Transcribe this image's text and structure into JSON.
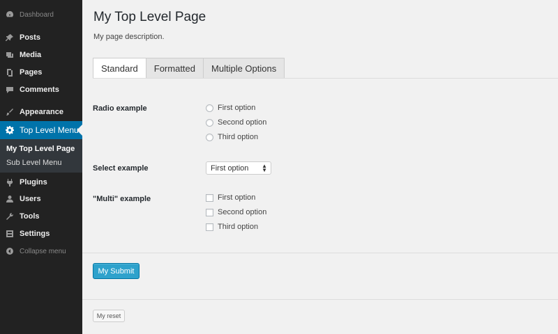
{
  "sidebar": {
    "items": [
      {
        "label": "Dashboard",
        "icon": "dashboard-icon"
      },
      {
        "label": "Posts",
        "icon": "pin-icon"
      },
      {
        "label": "Media",
        "icon": "media-icon"
      },
      {
        "label": "Pages",
        "icon": "pages-icon"
      },
      {
        "label": "Comments",
        "icon": "comment-icon"
      },
      {
        "label": "Appearance",
        "icon": "brush-icon"
      },
      {
        "label": "Top Level Menu",
        "icon": "gear-icon"
      },
      {
        "label": "Plugins",
        "icon": "plugin-icon"
      },
      {
        "label": "Users",
        "icon": "users-icon"
      },
      {
        "label": "Tools",
        "icon": "wrench-icon"
      },
      {
        "label": "Settings",
        "icon": "settings-icon"
      },
      {
        "label": "Collapse menu",
        "icon": "collapse-icon"
      }
    ],
    "submenu": [
      {
        "label": "My Top Level Page"
      },
      {
        "label": "Sub Level Menu"
      }
    ]
  },
  "main": {
    "title": "My Top Level Page",
    "description": "My page description.",
    "tabs": [
      {
        "label": "Standard"
      },
      {
        "label": "Formatted"
      },
      {
        "label": "Multiple Options"
      }
    ],
    "radio": {
      "label": "Radio example",
      "options": [
        "First option",
        "Second option",
        "Third option"
      ]
    },
    "select": {
      "label": "Select example",
      "value": "First option"
    },
    "multi": {
      "label": "\"Multi\" example",
      "options": [
        "First option",
        "Second option",
        "Third option"
      ]
    },
    "submit_label": "My Submit",
    "reset_label": "My reset"
  },
  "colors": {
    "sidebar_bg": "#222222",
    "active_menu": "#0073aa",
    "submit_btn": "#2ea2cc"
  }
}
